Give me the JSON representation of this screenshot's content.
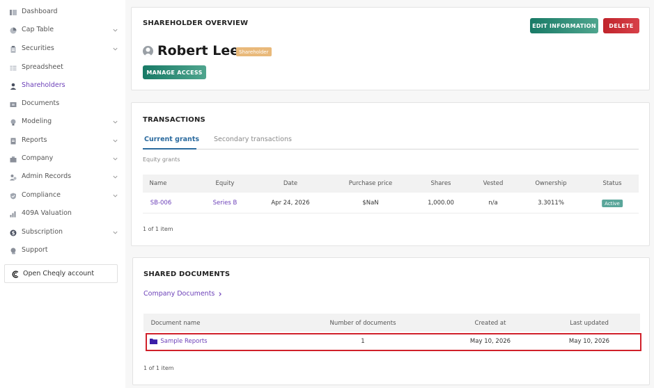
{
  "sidebar": {
    "items": [
      {
        "label": "Dashboard",
        "icon": "dashboard-icon",
        "has_chevron": false,
        "active": false
      },
      {
        "label": "Cap Table",
        "icon": "pie-chart-icon",
        "has_chevron": true,
        "active": false
      },
      {
        "label": "Securities",
        "icon": "clipboard-icon",
        "has_chevron": true,
        "active": false
      },
      {
        "label": "Spreadsheet",
        "icon": "spreadsheet-icon",
        "has_chevron": false,
        "active": false
      },
      {
        "label": "Shareholders",
        "icon": "person-icon",
        "has_chevron": false,
        "active": true
      },
      {
        "label": "Documents",
        "icon": "folder-icon",
        "has_chevron": false,
        "active": false
      },
      {
        "label": "Modeling",
        "icon": "lightbulb-icon",
        "has_chevron": true,
        "active": false
      },
      {
        "label": "Reports",
        "icon": "report-icon",
        "has_chevron": true,
        "active": false
      },
      {
        "label": "Company",
        "icon": "building-icon",
        "has_chevron": true,
        "active": false
      },
      {
        "label": "Admin Records",
        "icon": "admin-icon",
        "has_chevron": true,
        "active": false
      },
      {
        "label": "Compliance",
        "icon": "shield-check-icon",
        "has_chevron": true,
        "active": false
      },
      {
        "label": "409A Valuation",
        "icon": "bar-chart-icon",
        "has_chevron": false,
        "active": false
      },
      {
        "label": "Subscription",
        "icon": "dollar-icon",
        "has_chevron": true,
        "active": false
      },
      {
        "label": "Support",
        "icon": "support-icon",
        "has_chevron": false,
        "active": false
      }
    ],
    "open_account_label": "Open Cheqly account"
  },
  "overview": {
    "title": "SHAREHOLDER OVERVIEW",
    "edit_label": "EDIT INFORMATION",
    "delete_label": "DELETE",
    "name": "Robert Lee",
    "role_badge": "Shareholder",
    "manage_access_label": "MANAGE ACCESS"
  },
  "transactions": {
    "title": "TRANSACTIONS",
    "tabs": [
      "Current grants",
      "Secondary transactions"
    ],
    "active_tab": "Current grants",
    "section_label": "Equity grants",
    "columns": [
      "Name",
      "Equity",
      "Date",
      "Purchase price",
      "Shares",
      "Vested",
      "Ownership",
      "Status"
    ],
    "rows": [
      {
        "name": "SB-006",
        "equity": "Series B",
        "date": "Apr 24, 2026",
        "purchase_price": "$NaN",
        "shares": "1,000.00",
        "vested": "n/a",
        "ownership": "3.3011%",
        "status": "Active"
      }
    ],
    "footer": "1 of 1 item"
  },
  "shared_documents": {
    "title": "SHARED DOCUMENTS",
    "company_link": "Company Documents",
    "columns": [
      "Document name",
      "Number of documents",
      "Created at",
      "Last updated"
    ],
    "rows": [
      {
        "name": "Sample Reports",
        "count": "1",
        "created_at": "May 10, 2026",
        "last_updated": "May 10, 2026"
      }
    ],
    "footer": "1 of 1 item"
  },
  "colors": {
    "accent_purple": "#6b3fb8",
    "teal_button": "#187a66",
    "red_button": "#c0242b",
    "tab_blue": "#2a6a9e",
    "status_green": "#5aa69a",
    "badge_orange": "#e9b97a",
    "highlight_red": "#d0202a"
  }
}
